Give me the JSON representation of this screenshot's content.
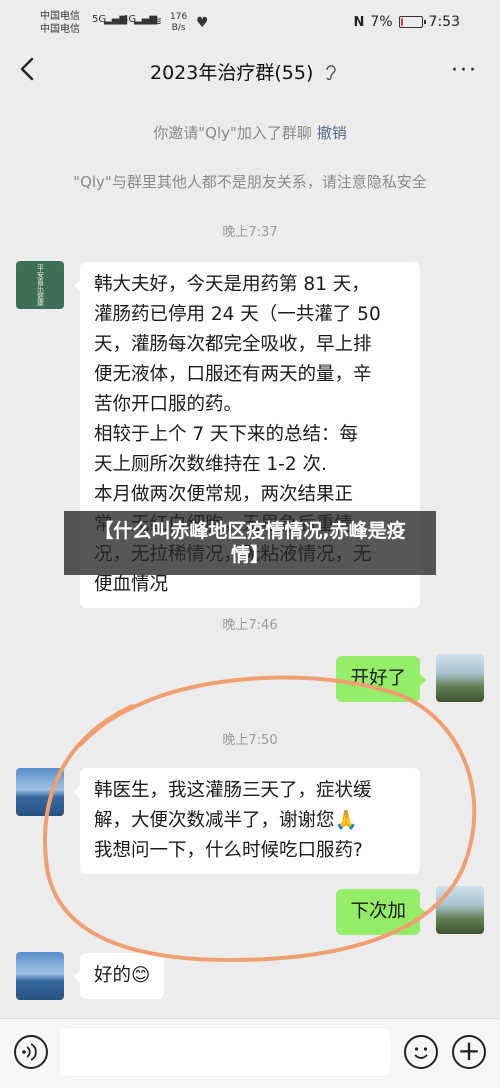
{
  "status_bar": {
    "carrier_1": "中国电信",
    "carrier_2": "中国电信",
    "net_1": "5G",
    "net_2": "4G",
    "speed_value": "176",
    "speed_unit": "B/s",
    "battery_text": "7%",
    "battery_level": 0.07,
    "time": "7:53"
  },
  "header": {
    "title": "2023年治疗群(55)",
    "more_label": "···"
  },
  "system_messages": {
    "invite_prefix": "你邀请\"Qly\"加入了群聊",
    "invite_link": "撤销",
    "privacy_note": "\"Qly\"与群里其他人都不是朋友关系，请注意隐私安全"
  },
  "timestamps": [
    "晚上7:37",
    "晚上7:46",
    "晚上7:50"
  ],
  "messages": [
    {
      "side": "left",
      "avatar": "green-calligraphy-avatar",
      "avatar_text": "平安喜乐健康",
      "text": "韩大夫好，今天是用药第 81 天，\n灌肠药已停用 24 天（一共灌了 50\n天，灌肠每次都完全吸收，早上排\n便无液体，口服还有两天的量，辛\n苦你开口服的药。\n相较于上个 7 天下来的总结：每\n天上厕所次数维持在 1-2 次.\n本月做两次便常规，两次结果正\n常，无红白细胞，无里急后重情\n况，无拉稀情况，无粘液情况，无\n便血情况"
    },
    {
      "side": "right",
      "avatar": "pagoda-avatar",
      "text": "开好了"
    },
    {
      "side": "left",
      "avatar": "sea-avatar",
      "text": "韩医生，我这灌肠三天了，症状缓\n解，大便次数减半了，谢谢您🙏\n我想问一下，什么时候吃口服药?"
    },
    {
      "side": "right",
      "avatar": "pagoda-avatar",
      "text": "下次加"
    },
    {
      "side": "left",
      "avatar": "sea-avatar",
      "text": "好的😊"
    }
  ],
  "overlay_caption": "【什么叫赤峰地区疫情情况,赤峰是疫\n情】",
  "colors": {
    "background": "#ececec",
    "my_bubble": "#95ec69",
    "link": "#576b95",
    "annotation_circle": "#f0a070"
  }
}
